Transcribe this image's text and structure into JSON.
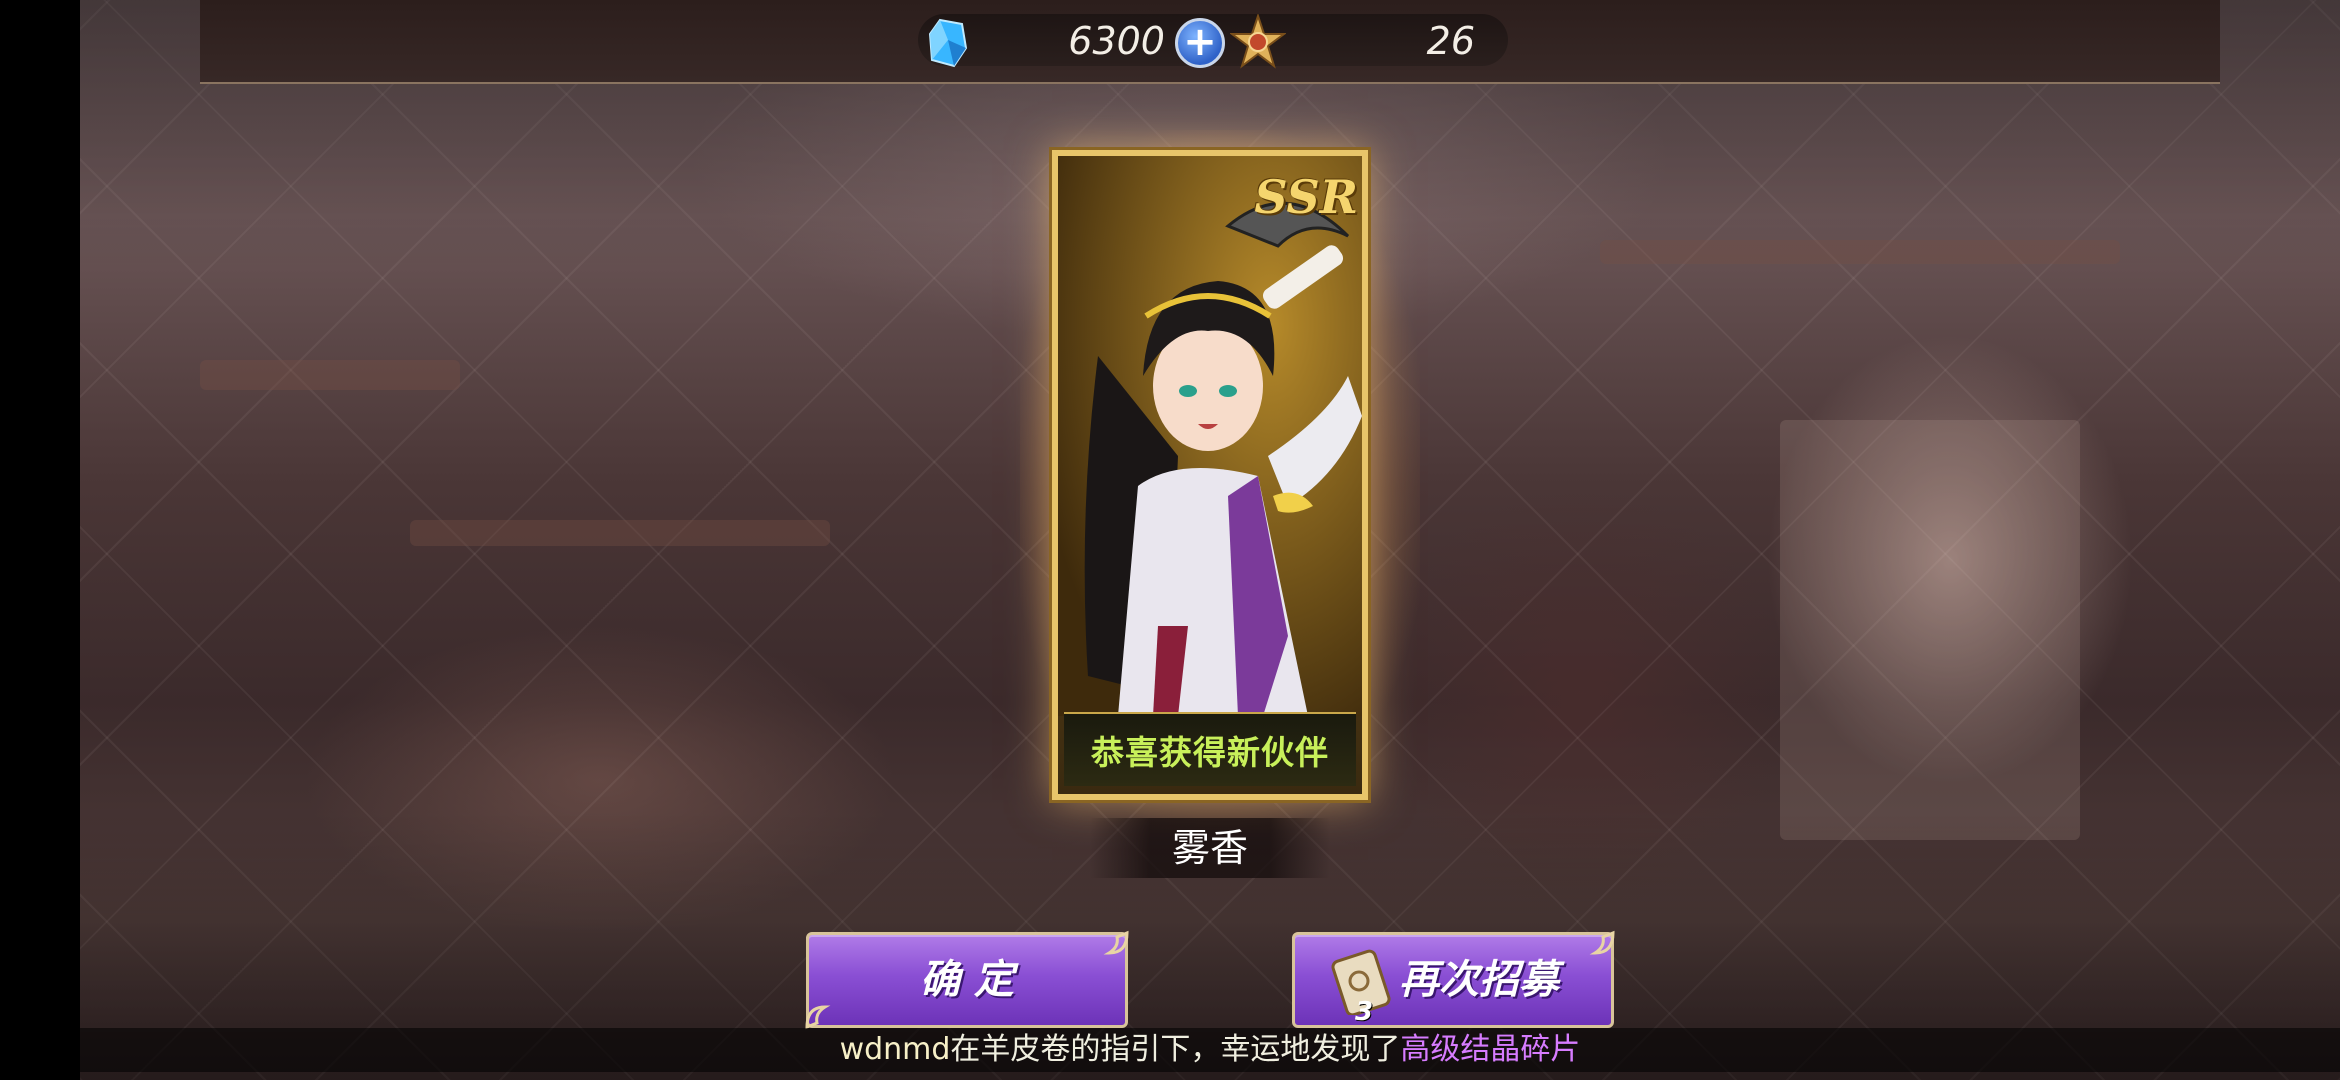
{
  "resources": {
    "gems": "6300",
    "tickets": "26"
  },
  "card": {
    "rarity": "SSR",
    "banner_text": "恭喜获得新伙伴",
    "character_name": "雾香"
  },
  "buttons": {
    "confirm_label": "确 定",
    "recruit_again_label": "再次招募",
    "recruit_cost": "3"
  },
  "broadcast": {
    "user": "wdnmd",
    "message": "在羊皮卷的指引下，幸运地发现了",
    "item": "高级结晶碎片"
  },
  "colors": {
    "gem": "#38b6ff",
    "button_purple": "#8a4fd4",
    "banner_text": "#c8f05a",
    "highlight_item": "#d77cff"
  }
}
